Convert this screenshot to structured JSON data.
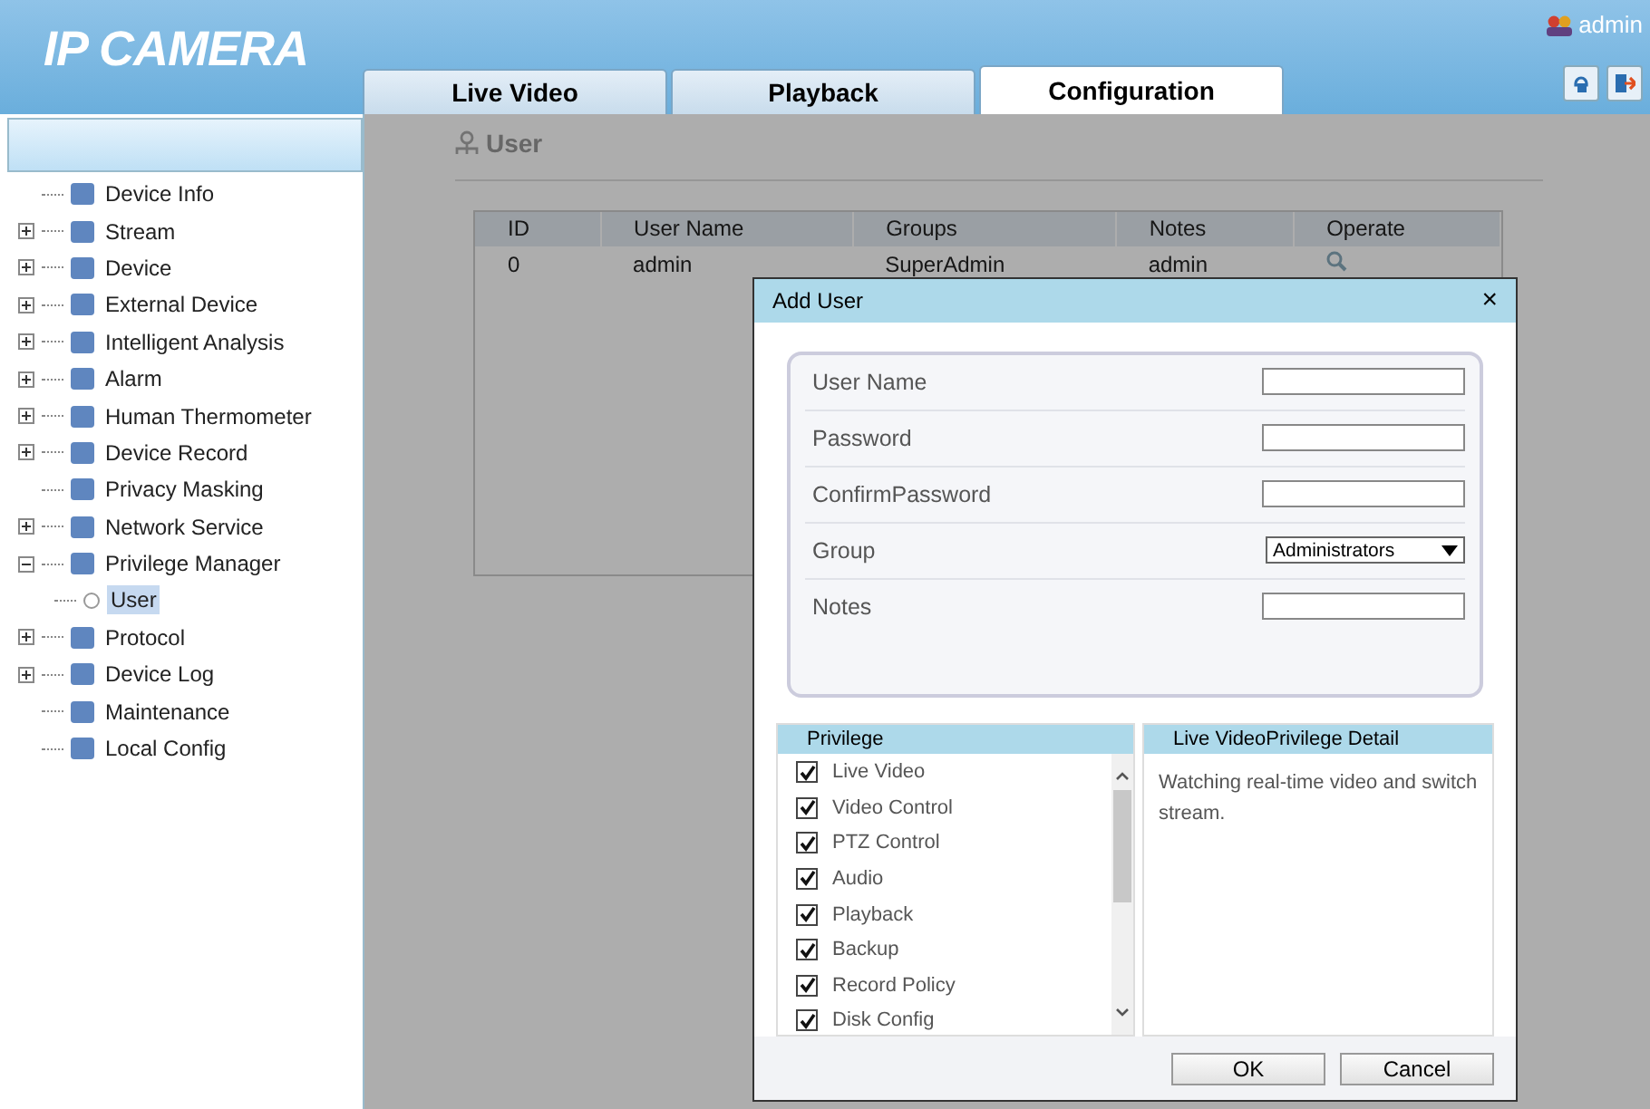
{
  "header": {
    "logo": "IP CAMERA",
    "user": "admin"
  },
  "tabs": [
    {
      "label": "Live Video",
      "selected": false
    },
    {
      "label": "Playback",
      "selected": false
    },
    {
      "label": "Configuration",
      "selected": true
    }
  ],
  "sidebar": {
    "items": [
      {
        "label": "Device Info",
        "selected": false
      },
      {
        "label": "Stream",
        "expanded": false,
        "selected": false
      },
      {
        "label": "Device",
        "expanded": false,
        "selected": false
      },
      {
        "label": "External Device",
        "expanded": false,
        "selected": false
      },
      {
        "label": "Intelligent Analysis",
        "expanded": false,
        "selected": false
      },
      {
        "label": "Alarm",
        "expanded": false,
        "selected": false
      },
      {
        "label": "Human Thermometer",
        "expanded": false,
        "selected": false
      },
      {
        "label": "Device Record",
        "expanded": false,
        "selected": false
      },
      {
        "label": "Privacy Masking",
        "selected": false
      },
      {
        "label": "Network Service",
        "expanded": false,
        "selected": false
      },
      {
        "label": "Privilege Manager",
        "expanded": true,
        "selected": false,
        "children": [
          {
            "label": "User",
            "selected": true
          }
        ]
      },
      {
        "label": "Protocol",
        "expanded": false,
        "selected": false
      },
      {
        "label": "Device Log",
        "expanded": false,
        "selected": false
      },
      {
        "label": "Maintenance",
        "selected": false
      },
      {
        "label": "Local Config",
        "selected": false
      }
    ]
  },
  "page": {
    "title": "User",
    "table": {
      "columns": [
        "ID",
        "User Name",
        "Groups",
        "Notes",
        "Operate"
      ],
      "rows": [
        [
          "0",
          "admin",
          "SuperAdmin",
          "admin"
        ]
      ]
    }
  },
  "dialog": {
    "title": "Add User",
    "close": "×",
    "fields": [
      {
        "label": "User Name",
        "kind": "text"
      },
      {
        "label": "Password",
        "kind": "text"
      },
      {
        "label": "ConfirmPassword",
        "kind": "text"
      },
      {
        "label": "Group",
        "kind": "select",
        "value": "Administrators"
      },
      {
        "label": "Notes",
        "kind": "text"
      }
    ],
    "privilege_header": "Privilege",
    "privileges": [
      {
        "label": "Live Video",
        "checked": true
      },
      {
        "label": "Video Control",
        "checked": true
      },
      {
        "label": "PTZ Control",
        "checked": true
      },
      {
        "label": "Audio",
        "checked": true
      },
      {
        "label": "Playback",
        "checked": true
      },
      {
        "label": "Backup",
        "checked": true
      },
      {
        "label": "Record Policy",
        "checked": true
      },
      {
        "label": "Disk Config",
        "checked": true
      }
    ],
    "detail_header": "Live VideoPrivilege Detail",
    "detail_text": "Watching real-time video and switch stream.",
    "buttons": [
      "OK",
      "Cancel"
    ]
  }
}
